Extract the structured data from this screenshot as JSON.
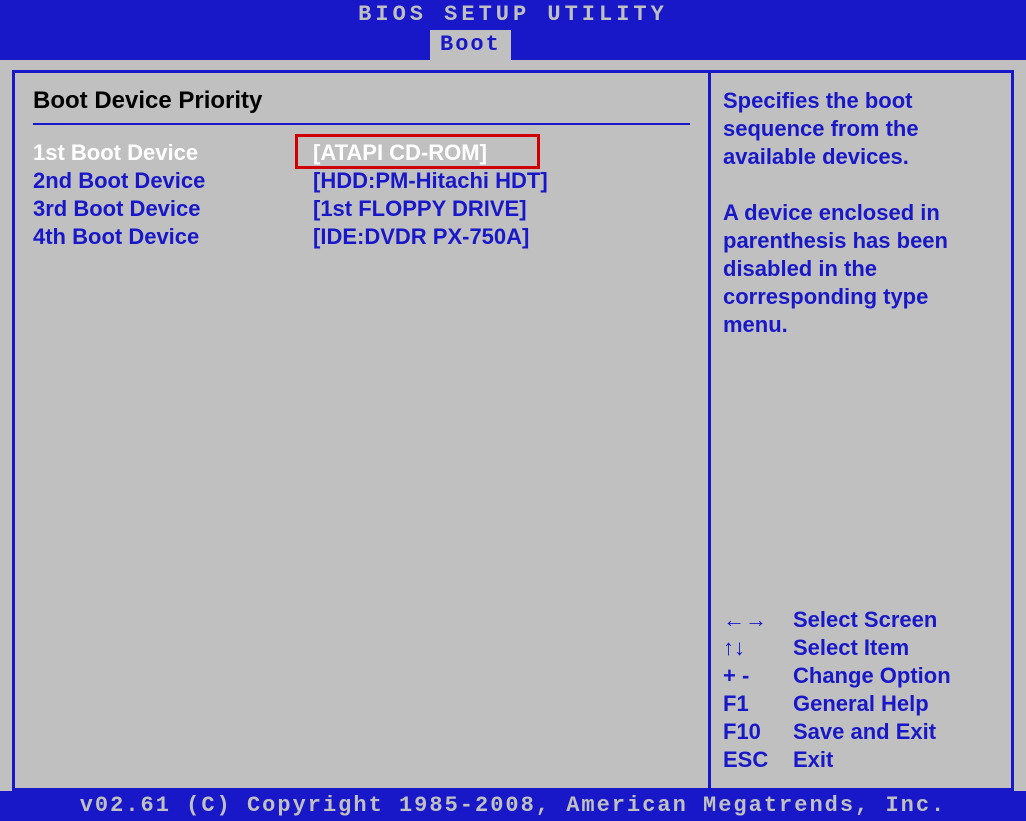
{
  "header": {
    "title": "BIOS SETUP UTILITY",
    "tab": "Boot"
  },
  "main": {
    "section_title": "Boot Device Priority",
    "boot_devices": [
      {
        "label": "1st Boot Device",
        "value": "[ATAPI CD-ROM]",
        "selected": true,
        "highlighted": true
      },
      {
        "label": "2nd Boot Device",
        "value": "[HDD:PM-Hitachi HDT]",
        "selected": false
      },
      {
        "label": "3rd Boot Device",
        "value": "[1st FLOPPY DRIVE]",
        "selected": false
      },
      {
        "label": "4th Boot Device",
        "value": "[IDE:DVDR PX-750A]",
        "selected": false
      }
    ]
  },
  "help": {
    "paragraph1": "Specifies the boot sequence from the available devices.",
    "paragraph2": "A device enclosed in parenthesis has been disabled in the corresponding type menu."
  },
  "nav": [
    {
      "key": "←→",
      "action": "Select Screen"
    },
    {
      "key": "↑↓",
      "action": "Select Item"
    },
    {
      "key": "+ -",
      "action": "Change Option"
    },
    {
      "key": "F1",
      "action": "General Help"
    },
    {
      "key": "F10",
      "action": "Save and Exit"
    },
    {
      "key": "ESC",
      "action": "Exit"
    }
  ],
  "footer": {
    "text": "v02.61 (C) Copyright 1985-2008, American Megatrends, Inc."
  }
}
